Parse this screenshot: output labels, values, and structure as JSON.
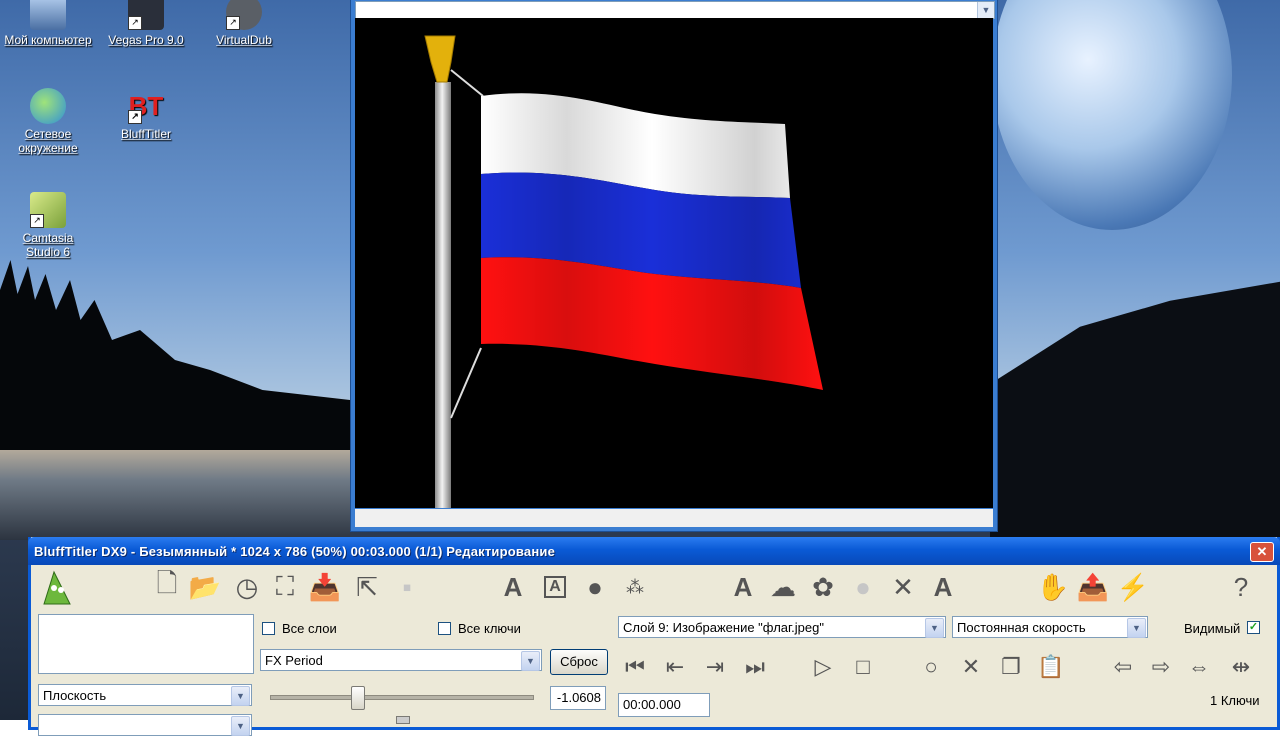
{
  "desktop": {
    "icons": [
      {
        "name": "my-computer",
        "label": "Мой компьютер",
        "icon": "computer-icon"
      },
      {
        "name": "vegas-pro",
        "label": "Vegas Pro 9.0",
        "icon": "vegas-icon"
      },
      {
        "name": "virtualdub",
        "label": "VirtualDub",
        "icon": "gear-icon"
      },
      {
        "name": "network",
        "label": "Сетевое окружение",
        "icon": "network-globe-icon"
      },
      {
        "name": "blufftitler",
        "label": "BluffTitler",
        "icon": "blufftitler-icon"
      },
      {
        "name": "camtasia",
        "label": "Camtasia Studio 6",
        "icon": "camtasia-icon"
      }
    ]
  },
  "preview": {
    "dropdown_value": "",
    "colors": {
      "flag_white": "#ffffff",
      "flag_blue": "#1a2fd8",
      "flag_red": "#ff1010",
      "pole": "#d9d9d9",
      "finial": "#e8b60e"
    }
  },
  "app": {
    "title": "BluffTitler DX9 - Безымянный * 1024 x 786 (50%) 00:03.000 (1/1) Редактирование",
    "close_label": "✕",
    "toolbar": [
      "new-file-icon",
      "open-folder-icon",
      "clock-icon",
      "resize-icon",
      "import-icon",
      "select-arrow-icon",
      "disabled-icon",
      "text-layer-icon",
      "text-box-icon",
      "shape-layer-icon",
      "particles-icon",
      "add-text-icon",
      "ghost-icon",
      "cloud-icon",
      "blur-icon",
      "delete-layer-icon",
      "copy-text-icon",
      "hand-icon",
      "export-icon",
      "magic-wand-icon",
      "help-icon"
    ],
    "left": {
      "layer_type": "Плоскость",
      "second_select": ""
    },
    "middle": {
      "all_layers_label": "Все слои",
      "all_keys_label": "Все ключи",
      "fx_select": "FX Period",
      "reset_label": "Сброс",
      "slider_value": "-1.0608"
    },
    "right": {
      "layer_select": "Слой 9: Изображение \"флаг.jpeg\"",
      "speed_select": "Постоянная скорость",
      "visible_label": "Видимый",
      "visible_checked": true,
      "time_value": "00:00.000",
      "keys_label": "1 Ключи"
    }
  }
}
